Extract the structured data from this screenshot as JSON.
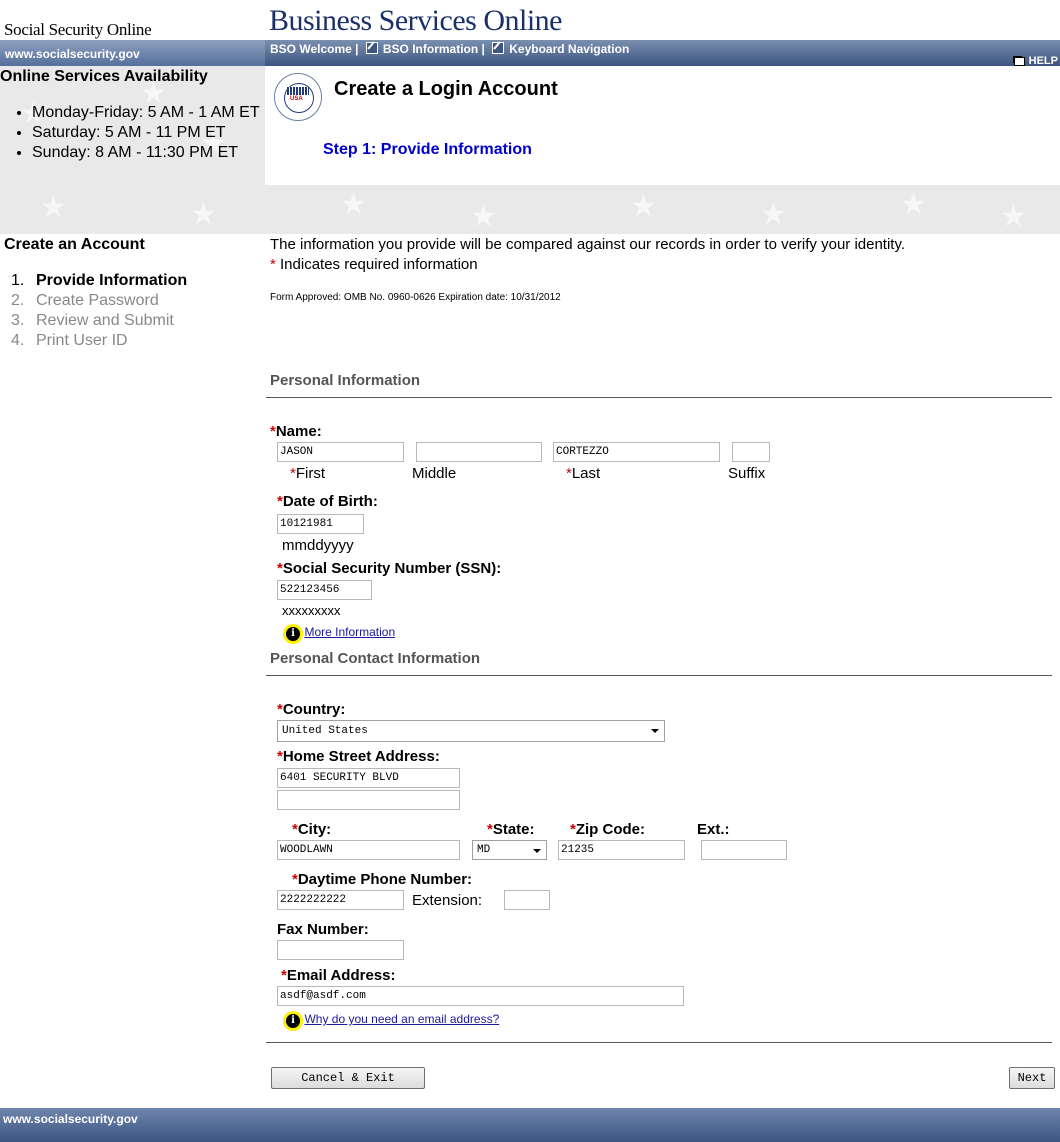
{
  "header": {
    "site_name": "Social Security Online",
    "app_title": "Business Services Online",
    "url_text": "www.socialsecurity.gov",
    "nav": {
      "bso_welcome": "BSO Welcome",
      "bso_information": "BSO Information",
      "keyboard_navigation": "Keyboard Navigation"
    },
    "help": "HELP"
  },
  "availability": {
    "title": "Online Services Availability",
    "items": [
      "Monday-Friday: 5 AM - 1 AM ET",
      "Saturday: 5 AM - 11 PM ET",
      "Sunday: 8 AM - 11:30 PM ET"
    ]
  },
  "page": {
    "title": "Create a Login Account",
    "step_title": "Step 1: Provide Information",
    "seal_text": "USA"
  },
  "sidebar": {
    "title": "Create an Account",
    "steps": [
      {
        "num": "1.",
        "label": "Provide Information"
      },
      {
        "num": "2.",
        "label": "Create Password"
      },
      {
        "num": "3.",
        "label": "Review and Submit"
      },
      {
        "num": "4.",
        "label": "Print User ID"
      }
    ]
  },
  "intro": {
    "line1": "The information you provide will be compared against our records in order to verify your identity.",
    "required_marker": "*",
    "line2": " Indicates required information",
    "omb": "Form Approved: OMB No. 0960-0626 Expiration date: 10/31/2012"
  },
  "personal": {
    "heading": "Personal Information",
    "name_label": "Name:",
    "first_value": "JASON",
    "middle_value": "",
    "last_value": "CORTEZZO",
    "suffix_value": "",
    "first_label": "First",
    "middle_label": "Middle",
    "last_label": "Last",
    "suffix_label": "Suffix",
    "dob_label": "Date of Birth:",
    "dob_value": "10121981",
    "dob_hint": "mmddyyyy",
    "ssn_label": "Social Security Number (SSN):",
    "ssn_value": "522123456",
    "ssn_hint": "xxxxxxxxx",
    "more_info": "More Information"
  },
  "contact": {
    "heading": "Personal Contact Information",
    "country_label": "Country:",
    "country_value": "United States",
    "street_label": "Home Street Address:",
    "street1_value": "6401 SECURITY BLVD",
    "street2_value": "",
    "city_label": "City:",
    "city_value": "WOODLAWN",
    "state_label": "State:",
    "state_value": "MD",
    "zip_label": "Zip Code:",
    "zip_value": "21235",
    "ext_label": "Ext.:",
    "ext_value": "",
    "phone_label": "Daytime Phone Number:",
    "phone_value": "2222222222",
    "extension_label": "Extension:",
    "extension_value": "",
    "fax_label": "Fax Number:",
    "fax_value": "",
    "email_label": "Email Address:",
    "email_value": "asdf@asdf.com",
    "email_why": "Why do you need an email address?"
  },
  "actions": {
    "cancel": "Cancel & Exit",
    "next": "Next"
  },
  "footer": {
    "url_text": "www.socialsecurity.gov"
  }
}
